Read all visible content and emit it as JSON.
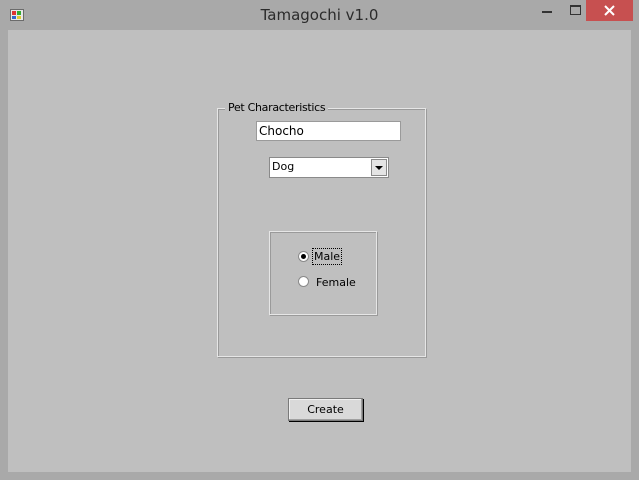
{
  "window": {
    "title": "Tamagochi v1.0",
    "icon": "app-icon",
    "controls": {
      "minimize": "minimize-icon",
      "maximize": "maximize-icon",
      "close": "close-icon"
    }
  },
  "form": {
    "group_title": "Pet Characteristics",
    "name_value": "Chocho",
    "species_selected": "Dog",
    "gender": {
      "options": [
        {
          "label": "Male",
          "selected": true
        },
        {
          "label": "Female",
          "selected": false
        }
      ]
    },
    "create_label": "Create"
  },
  "colors": {
    "close_button": "#c75050",
    "client_bg": "#bfbfbf",
    "frame": "#a9a9a9"
  }
}
